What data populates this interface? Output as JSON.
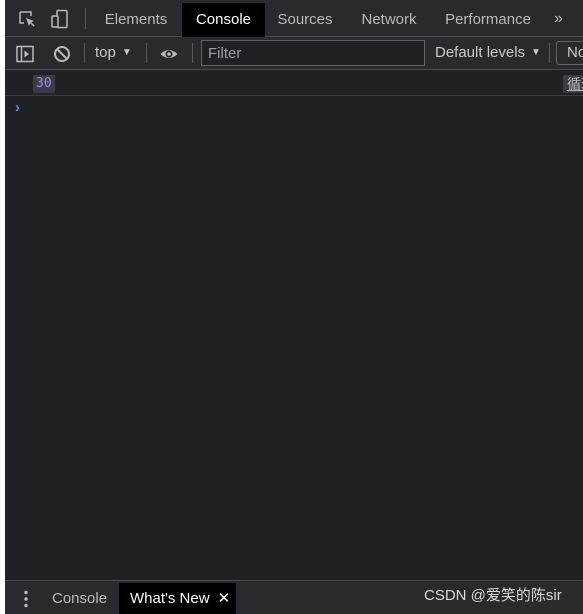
{
  "tabs": [
    {
      "label": "Elements",
      "active": false
    },
    {
      "label": "Console",
      "active": true
    },
    {
      "label": "Sources",
      "active": false
    },
    {
      "label": "Network",
      "active": false
    },
    {
      "label": "Performance",
      "active": false
    }
  ],
  "more_tabs_symbol": "»",
  "toolbar": {
    "context": "top",
    "filter_placeholder": "Filter",
    "levels": "Default levels",
    "issues_label": "No Issues"
  },
  "console": {
    "messages": [
      {
        "value": "30",
        "source": "循环"
      }
    ],
    "prompt_symbol": "›"
  },
  "drawer": {
    "tabs": [
      {
        "label": "Console",
        "active": false
      },
      {
        "label": "What's New",
        "active": true
      }
    ],
    "close_symbol": "✕"
  },
  "watermark": "CSDN @爱笑的陈sir",
  "colors": {
    "panel_bg": "#202124",
    "toolbar_bg": "#292a2d",
    "active_tab_bg": "#000000",
    "number_value": "#9c8cff",
    "prompt_accent": "#4a8df8"
  },
  "icons": {
    "inspect": "inspect-element-icon",
    "device": "device-toolbar-icon",
    "sidebar": "show-sidebar-icon",
    "clear": "clear-console-icon",
    "eye": "live-expression-icon",
    "menu": "kebab-menu-icon"
  }
}
